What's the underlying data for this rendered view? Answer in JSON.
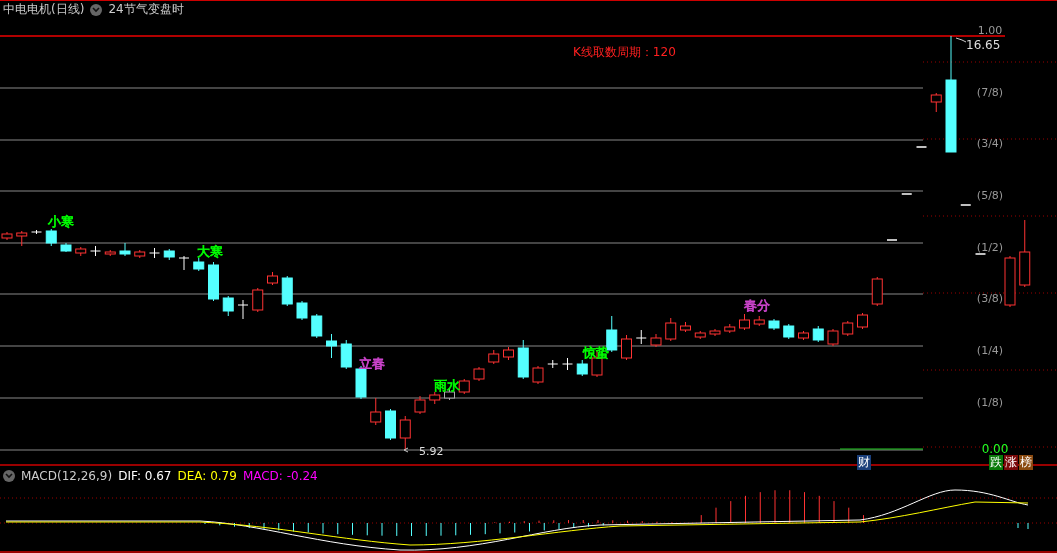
{
  "header": {
    "title": "中电电机(日线)",
    "indicator": "24节气变盘时"
  },
  "period_label": "K线取数周期：120",
  "axis_labels": [
    "1.00",
    "(7/8)",
    "(3/4)",
    "(5/8)",
    "(1/2)",
    "(3/8)",
    "(1/4)",
    "(1/8)"
  ],
  "axis_zero": "0.00",
  "high_label": "16.65",
  "low_label": "5.92",
  "solar_terms": [
    {
      "label": "小寒",
      "color": "#00ff00"
    },
    {
      "label": "大寒",
      "color": "#00ff00"
    },
    {
      "label": "立春",
      "color": "#cc44cc"
    },
    {
      "label": "雨水",
      "color": "#00ff00"
    },
    {
      "label": "惊蛰",
      "color": "#00ff00"
    },
    {
      "label": "春分",
      "color": "#cc44cc"
    }
  ],
  "badges": [
    {
      "label": "财",
      "color": "#1a3e7a"
    },
    {
      "label": "跌",
      "color": "#0a7a0a"
    },
    {
      "label": "涨",
      "color": "#7a0a0a"
    },
    {
      "label": "榜",
      "color": "#8a4a10"
    }
  ],
  "macd": {
    "name": "MACD(12,26,9)",
    "values": [
      {
        "label": "DIF: 0.67",
        "color": "#ffffff"
      },
      {
        "label": "DEA: 0.79",
        "color": "#ffff00"
      },
      {
        "label": "MACD: -0.24",
        "color": "#ff00ff"
      }
    ]
  }
}
